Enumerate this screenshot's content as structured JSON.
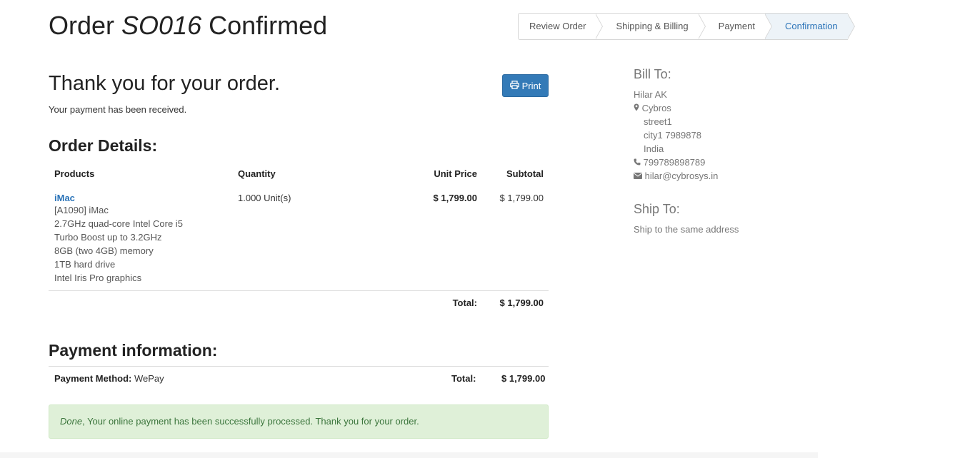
{
  "header": {
    "title_prefix": "Order",
    "order_number": "SO016",
    "title_suffix": "Confirmed"
  },
  "wizard": {
    "steps": [
      "Review Order",
      "Shipping & Billing",
      "Payment",
      "Confirmation"
    ],
    "active": "Confirmation"
  },
  "thanks": {
    "title": "Thank you for your order.",
    "subtitle": "Your payment has been received."
  },
  "print_button": {
    "label": "Print",
    "icon": "print-icon"
  },
  "order_details": {
    "heading": "Order Details:",
    "columns": {
      "products": "Products",
      "quantity": "Quantity",
      "unit_price": "Unit Price",
      "subtotal": "Subtotal"
    },
    "lines": [
      {
        "product": "iMac",
        "description": [
          "[A1090] iMac",
          "2.7GHz quad-core Intel Core i5",
          "Turbo Boost up to 3.2GHz",
          "8GB (two 4GB) memory",
          "1TB hard drive",
          "Intel Iris Pro graphics"
        ],
        "quantity": "1.000 Unit(s)",
        "unit_price": "$ 1,799.00",
        "subtotal": "$ 1,799.00"
      }
    ],
    "total_label": "Total:",
    "total_value": "$ 1,799.00"
  },
  "payment_info": {
    "heading": "Payment information:",
    "method_label": "Payment Method:",
    "method_value": "WePay",
    "total_label": "Total:",
    "total_value": "$ 1,799.00"
  },
  "alert": {
    "strong": "Done",
    "message": ", Your online payment has been successfully processed. Thank you for your order.",
    "color": "#dff0d8"
  },
  "bill_to": {
    "heading": "Bill To:",
    "name": "Hilar AK",
    "company": "Cybros",
    "street": "street1",
    "city": "city1 7989878",
    "country": "India",
    "phone": "799789898789",
    "email": "hilar@cybrosys.in",
    "icons": [
      "map-marker-icon",
      "phone-icon",
      "envelope-icon"
    ]
  },
  "ship_to": {
    "heading": "Ship To:",
    "text": "Ship to the same address"
  },
  "colors": {
    "accent": "#337ab7",
    "link": "#2a73b8",
    "success_bg": "#dff0d8",
    "success_text": "#3c763d"
  }
}
